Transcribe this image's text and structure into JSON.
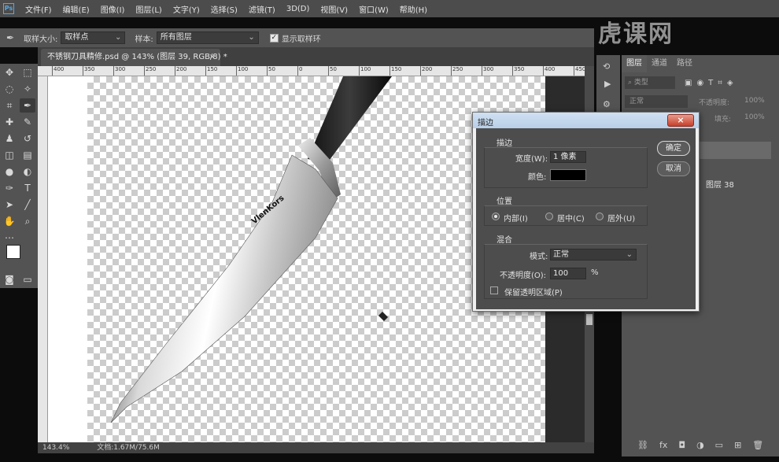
{
  "menubar": {
    "app_icon": "Ps",
    "items": [
      "文件(F)",
      "编辑(E)",
      "图像(I)",
      "图层(L)",
      "文字(Y)",
      "选择(S)",
      "滤镜(T)",
      "3D(D)",
      "视图(V)",
      "窗口(W)",
      "帮助(H)"
    ]
  },
  "watermark": "虎课网",
  "options": {
    "sample_size_label": "取样大小:",
    "sample_size_value": "取样点",
    "sample_label": "样本:",
    "sample_value": "所有图层",
    "show_ring_label": "显示取样环"
  },
  "document": {
    "tab_title": "不锈钢刀具精修.psd @ 143% (图层 39, RGB/8) *",
    "close": "×",
    "ruler_ticks": [
      "400",
      "350",
      "300",
      "250",
      "200",
      "150",
      "100",
      "50",
      "0",
      "50",
      "100",
      "150",
      "200",
      "250",
      "300",
      "350",
      "400",
      "450"
    ],
    "brand_text": "VlenKors"
  },
  "status": {
    "zoom": "143.4%",
    "doc_info": "文档:1.67M/75.6M"
  },
  "layers_panel": {
    "tabs": [
      "图层",
      "通道",
      "路径"
    ],
    "search_placeholder": "类型",
    "blend_mode": "正常",
    "opacity_label": "不透明度:",
    "opacity_value": "100%",
    "fill_label": "填充:",
    "fill_value": "100%",
    "visible_layer_name": "图层 38"
  },
  "stroke_dialog": {
    "title": "描边",
    "close": "×",
    "stroke_group": "描边",
    "width_label": "宽度(W):",
    "width_value": "1 像素",
    "color_label": "颜色:",
    "stroke_color": "#000000",
    "position_group": "位置",
    "position_options": [
      "内部(I)",
      "居中(C)",
      "居外(U)"
    ],
    "position_selected": "内部(I)",
    "blend_group": "混合",
    "mode_label": "模式:",
    "mode_value": "正常",
    "opacity_label": "不透明度(O):",
    "opacity_value": "100",
    "opacity_unit": "%",
    "preserve_label": "保留透明区域(P)",
    "ok": "确定",
    "cancel": "取消"
  },
  "colors": {
    "menubar": "#4c4c4c",
    "panel": "#535353",
    "dialog_body": "#4d4d4d",
    "ps_blue": "#5aa7e3"
  }
}
